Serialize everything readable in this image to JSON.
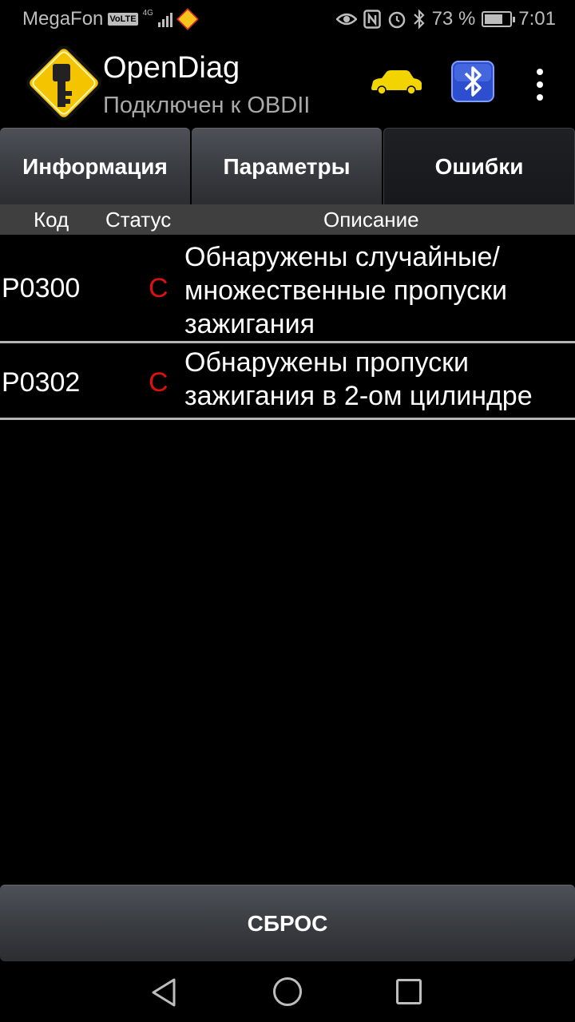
{
  "status_bar": {
    "carrier": "MegaFon",
    "volte": "VoLTE",
    "network": "4G",
    "battery_percent": "73 %",
    "battery_level": 0.73,
    "time": "7:01",
    "icons": [
      "eye-icon",
      "nfc-icon",
      "alarm-icon",
      "bluetooth-icon",
      "battery-icon"
    ]
  },
  "app_bar": {
    "title": "OpenDiag",
    "subtitle": "Подключен к OBDII",
    "car_icon_color": "#f2d400",
    "bt_icon_color": "#2d4fcf"
  },
  "tabs": [
    {
      "label": "Информация",
      "active": false
    },
    {
      "label": "Параметры",
      "active": false
    },
    {
      "label": "Ошибки",
      "active": true
    }
  ],
  "table": {
    "headers": {
      "code": "Код",
      "status": "Статус",
      "description": "Описание"
    },
    "rows": [
      {
        "code": "P0300",
        "status": "C",
        "description": "Обнаружены случайные/ множественные пропуски зажигания"
      },
      {
        "code": "P0302",
        "status": "C",
        "description": "Обнаружены пропуски зажигания в 2-ом цилиндре"
      }
    ]
  },
  "reset_button": {
    "label": "СБРОС"
  },
  "colors": {
    "status_error": "#e01010",
    "background": "#000000",
    "header_bg": "#3f3f3f"
  }
}
